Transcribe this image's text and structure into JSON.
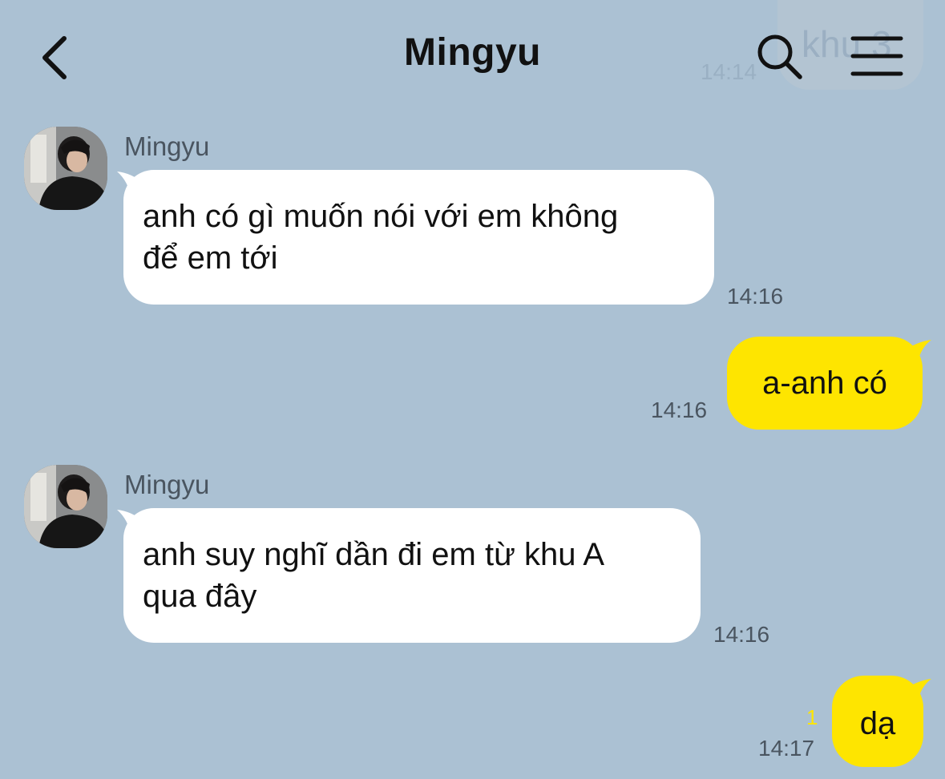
{
  "header": {
    "title": "Mingyu",
    "back_icon": "chevron-left-icon",
    "search_icon": "search-icon",
    "menu_icon": "hamburger-menu-icon",
    "ghost_text": "khu 3",
    "ghost_time": "14:14"
  },
  "colors": {
    "background": "#abc1d3",
    "incoming_bubble": "#ffffff",
    "outgoing_bubble": "#fee500",
    "timestamp": "#4a5560",
    "unread_count": "#fee500"
  },
  "messages": [
    {
      "direction": "incoming",
      "sender": "Mingyu",
      "lines": [
        "anh có gì muốn nói với em không",
        "để em tới"
      ],
      "time": "14:16"
    },
    {
      "direction": "outgoing",
      "text": "a-anh có",
      "time": "14:16"
    },
    {
      "direction": "incoming",
      "sender": "Mingyu",
      "lines": [
        "anh suy nghĩ dần đi em từ khu A",
        "qua đây"
      ],
      "time": "14:16"
    },
    {
      "direction": "outgoing",
      "text": "dạ",
      "time": "14:17",
      "unread": "1"
    }
  ]
}
